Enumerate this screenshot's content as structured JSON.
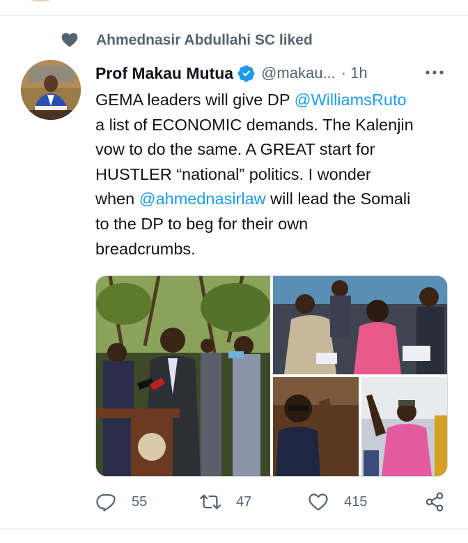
{
  "social_context": {
    "text": "Ahmednasir Abdullahi SC liked",
    "icon": "heart-icon"
  },
  "tweet": {
    "author_name": "Prof Makau Mutua",
    "verified": true,
    "handle": "@makau...",
    "separator": "·",
    "time": "1h",
    "text_parts": [
      {
        "text": "GEMA leaders will give DP ",
        "type": "text"
      },
      {
        "text": "@WilliamsRuto",
        "type": "mention"
      },
      {
        "text": "\na list of ECONOMIC demands.  The Kalenjin\nvow to do the same.  A GREAT start for\nHUSTLER “national” politics.  I wonder\nwhen ",
        "type": "text"
      },
      {
        "text": "@ahmednasirlaw",
        "type": "mention"
      },
      {
        "text": " will lead the Somali\nto the DP to beg for their own\nbreadcrumbs.",
        "type": "text"
      }
    ],
    "media_count": 4
  },
  "actions": {
    "reply": {
      "icon": "reply-icon",
      "count": "55"
    },
    "retweet": {
      "icon": "retweet-icon",
      "count": "47"
    },
    "like": {
      "icon": "heart-outline-icon",
      "count": "415"
    },
    "share": {
      "icon": "share-icon"
    }
  },
  "colors": {
    "accent": "#1d9bf0",
    "muted": "#536471",
    "text": "#0f1419",
    "border": "#e6ecf0"
  }
}
